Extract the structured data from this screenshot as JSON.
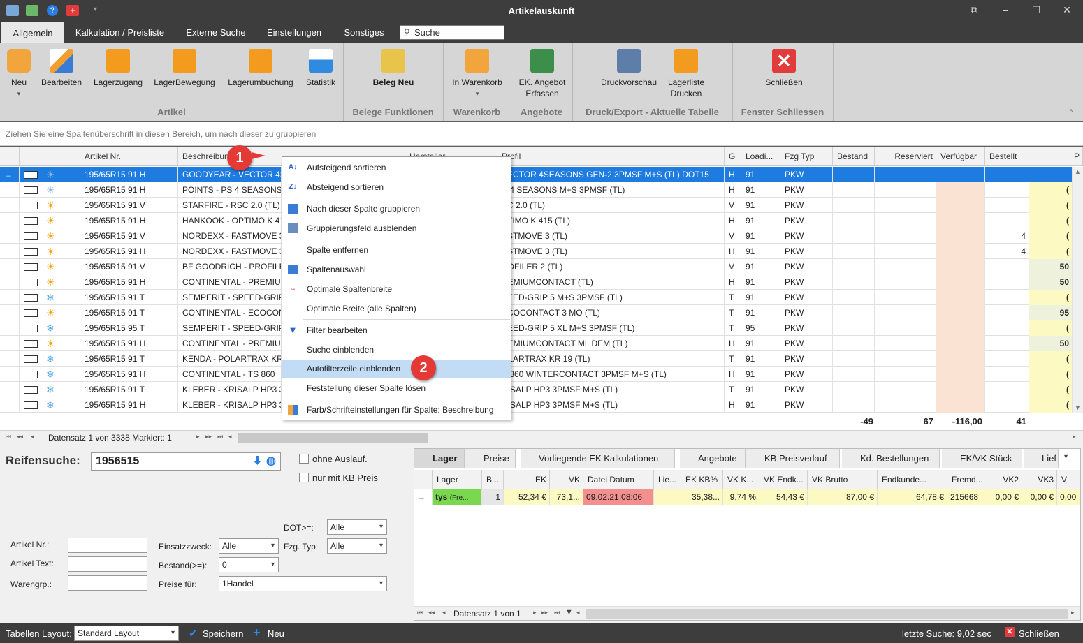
{
  "window": {
    "title": "Artikelauskunft",
    "controls": [
      "⧉",
      "–",
      "☐",
      "✕"
    ]
  },
  "tabs": [
    "Allgemein",
    "Kalkulation / Preisliste",
    "Externe Suche",
    "Einstellungen",
    "Sonstiges"
  ],
  "search": {
    "placeholder": "Suche"
  },
  "ribbon": {
    "buttons": [
      {
        "label": "Neu",
        "sub": "▾",
        "icon": "new-doc-icon"
      },
      {
        "label": "Bearbeiten",
        "icon": "pencil-icon"
      },
      {
        "label": "Lagerzugang",
        "icon": "stock-add-icon"
      },
      {
        "label": "LagerBewegung",
        "icon": "stock-move-icon"
      },
      {
        "label": "Lagerumbuchung",
        "icon": "stock-rebook-icon"
      },
      {
        "label": "Statistik",
        "icon": "chart-icon"
      },
      {
        "label": "Beleg Neu",
        "icon": "receipt-new-icon"
      },
      {
        "label": "In Warenkorb",
        "sub": "▾",
        "icon": "cart-icon"
      },
      {
        "label": "EK. Angebot",
        "label2": "Erfassen",
        "icon": "calculator-icon"
      },
      {
        "label": "Druckvorschau",
        "icon": "print-preview-icon"
      },
      {
        "label": "Lagerliste",
        "label2": "Drucken",
        "icon": "print-list-icon"
      },
      {
        "label": "Schließen",
        "icon": "close-red-icon"
      }
    ],
    "groups": [
      "Artikel",
      "Belege Funktionen",
      "Warenkorb",
      "Angebote",
      "Druck/Export - Aktuelle Tabelle",
      "Fenster Schliessen"
    ]
  },
  "group_hint": "Ziehen Sie eine Spaltenüberschrift in diesen Bereich, um nach dieser zu gruppieren",
  "grid": {
    "headers": [
      "Artikel Nr.",
      "Beschreibung",
      "Hersteller",
      "Profil",
      "G",
      "Loadi...",
      "Fzg Typ",
      "Bestand",
      "Reserviert",
      "Verfügbar",
      "Bestellt",
      "P"
    ],
    "rows": [
      {
        "season": "allwetter",
        "nr": "195/65R15 91 H",
        "desc": "GOODYEAR - VECTOR 4S",
        "profil": "VECTOR 4SEASONS GEN-2 3PMSF M+S (TL) DOT15",
        "g": "H",
        "li": "91",
        "typ": "PKW",
        "bestellt": "",
        "p": ""
      },
      {
        "season": "allwetter",
        "nr": "195/65R15 91 H",
        "desc": "POINTS - PS 4 SEASONS",
        "profil": "S 4 SEASONS M+S 3PMSF (TL)",
        "g": "H",
        "li": "91",
        "typ": "PKW",
        "bestellt": "",
        "p": "("
      },
      {
        "season": "sommer",
        "nr": "195/65R15 91 V",
        "desc": "STARFIRE - RSC 2.0 (TL)",
        "profil": "SC 2.0 (TL)",
        "g": "V",
        "li": "91",
        "typ": "PKW",
        "bestellt": "",
        "p": "("
      },
      {
        "season": "sommer",
        "nr": "195/65R15 91 H",
        "desc": "HANKOOK - OPTIMO K 41",
        "profil": "PTIMO K 415 (TL)",
        "g": "H",
        "li": "91",
        "typ": "PKW",
        "bestellt": "",
        "p": "("
      },
      {
        "season": "sommer",
        "nr": "195/65R15 91 V",
        "desc": "NORDEXX - FASTMOVE 3",
        "profil": "ASTMOVE 3 (TL)",
        "g": "V",
        "li": "91",
        "typ": "PKW",
        "bestellt": "4",
        "p": "("
      },
      {
        "season": "sommer",
        "nr": "195/65R15 91 H",
        "desc": "NORDEXX - FASTMOVE 3",
        "profil": "ASTMOVE 3 (TL)",
        "g": "H",
        "li": "91",
        "typ": "PKW",
        "bestellt": "4",
        "p": "("
      },
      {
        "season": "sommer",
        "nr": "195/65R15 91 V",
        "desc": "BF GOODRICH - PROFILE",
        "profil": "ROFILER 2 (TL)",
        "g": "V",
        "li": "91",
        "typ": "PKW",
        "bestellt": "",
        "p": "50"
      },
      {
        "season": "sommer",
        "nr": "195/65R15 91 H",
        "desc": "CONTINENTAL - PREMIUM",
        "profil": "REMIUMCONTACT (TL)",
        "g": "H",
        "li": "91",
        "typ": "PKW",
        "bestellt": "",
        "p": "50"
      },
      {
        "season": "winter",
        "nr": "195/65R15 91 T",
        "desc": "SEMPERIT - SPEED-GRIP",
        "profil": "PEED-GRIP 5 M+S 3PMSF (TL)",
        "g": "T",
        "li": "91",
        "typ": "PKW",
        "bestellt": "",
        "p": "("
      },
      {
        "season": "sommer",
        "nr": "195/65R15 91 T",
        "desc": "CONTINENTAL - ECOCON",
        "profil": "ECOCONTACT 3 MO (TL)",
        "g": "T",
        "li": "91",
        "typ": "PKW",
        "bestellt": "",
        "p": "95"
      },
      {
        "season": "winter",
        "nr": "195/65R15 95 T",
        "desc": "SEMPERIT - SPEED-GRIP",
        "profil": "PEED-GRIP 5 XL M+S 3PMSF (TL)",
        "g": "T",
        "li": "95",
        "typ": "PKW",
        "bestellt": "",
        "p": "("
      },
      {
        "season": "sommer",
        "nr": "195/65R15 91 H",
        "desc": "CONTINENTAL - PREMIUM",
        "profil": "REMIUMCONTACT ML DEM (TL)",
        "g": "H",
        "li": "91",
        "typ": "PKW",
        "bestellt": "",
        "p": "50"
      },
      {
        "season": "winter",
        "nr": "195/65R15 91 T",
        "desc": "KENDA - POLARTRAX KR",
        "profil": "OLARTRAX KR 19 (TL)",
        "g": "T",
        "li": "91",
        "typ": "PKW",
        "bestellt": "",
        "p": "("
      },
      {
        "season": "winter",
        "nr": "195/65R15 91 H",
        "desc": "CONTINENTAL - TS 860",
        "profil": "S 860 WINTERCONTACT 3PMSF M+S (TL)",
        "g": "H",
        "li": "91",
        "typ": "PKW",
        "bestellt": "",
        "p": "("
      },
      {
        "season": "winter",
        "nr": "195/65R15 91 T",
        "desc": "KLEBER - KRISALP HP3 3",
        "profil": "RISALP HP3 3PMSF M+S (TL)",
        "g": "T",
        "li": "91",
        "typ": "PKW",
        "bestellt": "",
        "p": "("
      },
      {
        "season": "winter",
        "nr": "195/65R15 91 H",
        "desc": "KLEBER - KRISALP HP3 3",
        "profil": "RISALP HP3 3PMSF M+S (TL)",
        "g": "H",
        "li": "91",
        "typ": "PKW",
        "bestellt": "",
        "p": "("
      }
    ],
    "totals": {
      "bestand": "-49",
      "reserviert": "67",
      "verfuegbar": "-116,00",
      "bestellt": "41"
    },
    "nav": {
      "record": "Datensatz 1 von 3338 Markiert: 1"
    }
  },
  "context_menu": {
    "items": [
      "Aufsteigend sortieren",
      "Absteigend sortieren",
      "Nach dieser Spalte gruppieren",
      "Gruppierungsfeld ausblenden",
      "Spalte entfernen",
      "Spaltenauswahl",
      "Optimale Spaltenbreite",
      "Optimale Breite (alle Spalten)",
      "Filter bearbeiten",
      "Suche einblenden",
      "Autofilterzeile einblenden",
      "Feststellung dieser Spalte lösen",
      "Farb/Schrifteinstellungen für Spalte: Beschreibung"
    ],
    "highlighted": "Autofilterzeile einblenden",
    "badges": [
      "1",
      "2"
    ]
  },
  "reifensuche": {
    "label": "Reifensuche:",
    "value": "1956515"
  },
  "checkboxes": [
    "ohne Auslauf.",
    "nur mit KB Preis"
  ],
  "filters": {
    "artikel_nr": "Artikel Nr.:",
    "artikel_text": "Artikel Text:",
    "warengrp": "Warengrp.:",
    "einsatzzweck": {
      "label": "Einsatzzweck:",
      "value": "Alle"
    },
    "bestand": {
      "label": "Bestand(>=):",
      "value": "0"
    },
    "preise": {
      "label": "Preise für:",
      "value": "1Handel"
    },
    "dot": {
      "label": "DOT>=:",
      "value": "Alle"
    },
    "fzg_typ": {
      "label": "Fzg. Typ:",
      "value": "Alle"
    }
  },
  "lower_tabs": [
    "Lager",
    "Preise",
    "Vorliegende EK Kalkulationen",
    "Angebote",
    "KB Preisverlauf",
    "Kd. Bestellungen",
    "EK/VK Stück",
    "Lief"
  ],
  "lager": {
    "headers": [
      "Lager",
      "B...",
      "EK",
      "VK",
      "Datei Datum",
      "Lie...",
      "EK KB%",
      "VK K...",
      "VK Endk...",
      "VK Brutto",
      "Endkunde...",
      "Fremd...",
      "VK2",
      "VK3",
      "V"
    ],
    "row": {
      "lager": "tys",
      "lager_sub": "(Fre...",
      "b": "1",
      "ek": "52,34 €",
      "vk": "73,1...",
      "datum": "09.02.21 08:06",
      "lie": "",
      "ekkb": "35,38...",
      "vkk": "9,74 %",
      "vkendk": "54,43 €",
      "vkbrutto": "87,00 €",
      "endkunde": "64,78 €",
      "fremd": "215668",
      "vk2": "0,00 €",
      "vk3": "0,00 €",
      "v": "0,00"
    },
    "nav": "Datensatz 1 von 1"
  },
  "statusbar": {
    "layout_label": "Tabellen Layout:",
    "layout_value": "Standard Layout",
    "save": "Speichern",
    "new": "Neu",
    "last_search": "letzte Suche: 9,02 sec",
    "close": "Schließen"
  }
}
